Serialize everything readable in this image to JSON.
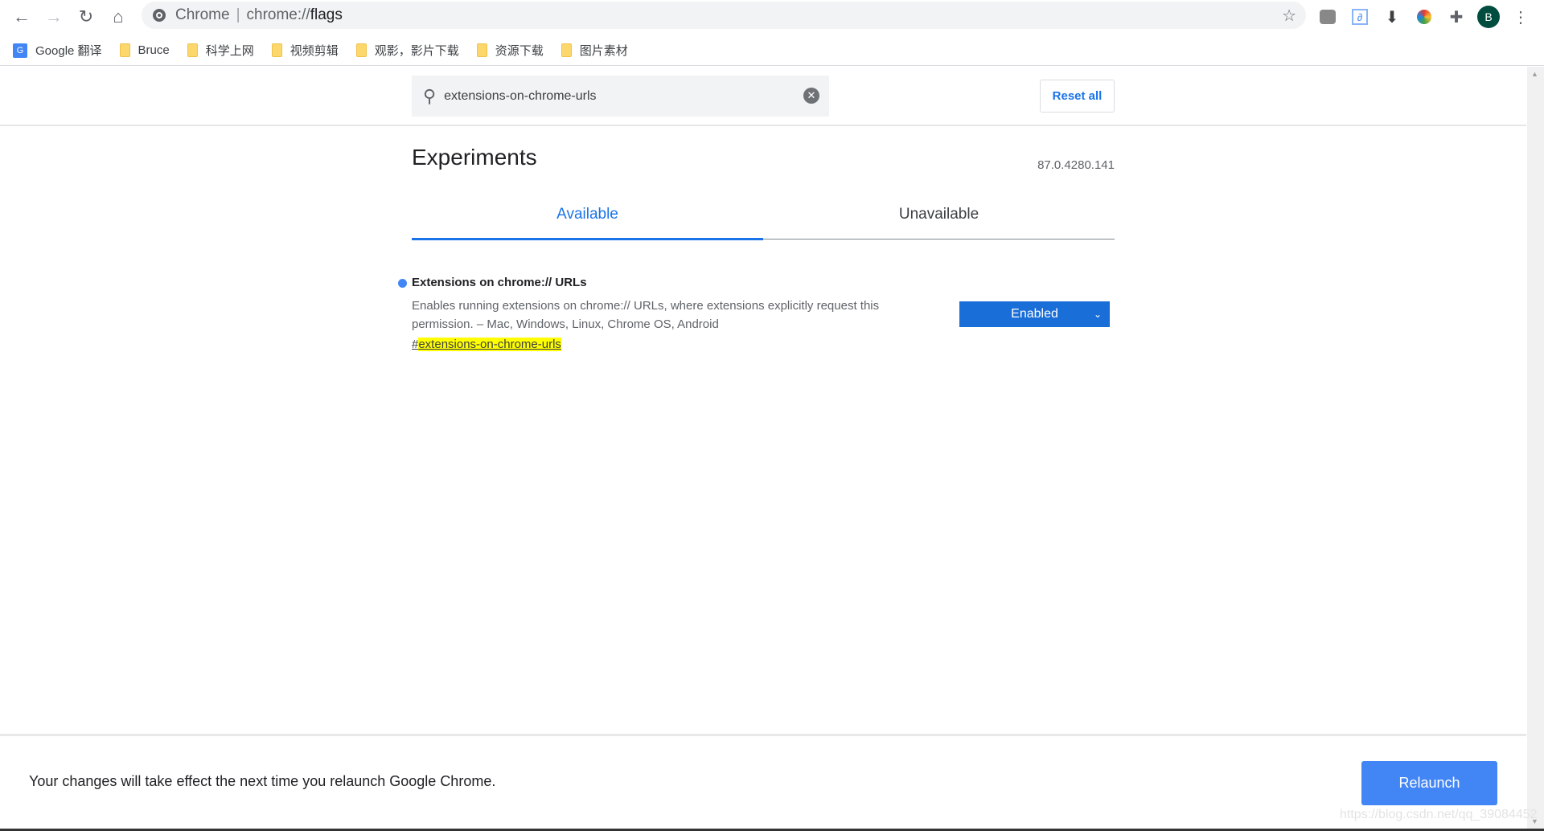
{
  "browser": {
    "site_label": "Chrome",
    "url_prefix": "chrome://",
    "url_path": "flags",
    "avatar_letter": "B",
    "bookmarks": [
      {
        "label": "Google 翻译",
        "icon": "google-translate-icon"
      },
      {
        "label": "Bruce",
        "icon": "folder-icon"
      },
      {
        "label": "科学上网",
        "icon": "folder-icon"
      },
      {
        "label": "视频剪辑",
        "icon": "folder-icon"
      },
      {
        "label": "观影，影片下载",
        "icon": "folder-icon"
      },
      {
        "label": "资源下载",
        "icon": "folder-icon"
      },
      {
        "label": "图片素材",
        "icon": "folder-icon"
      }
    ]
  },
  "search": {
    "value": "extensions-on-chrome-urls"
  },
  "header": {
    "reset_label": "Reset all"
  },
  "page": {
    "title": "Experiments",
    "version": "87.0.4280.141"
  },
  "tabs": [
    {
      "label": "Available",
      "active": true
    },
    {
      "label": "Unavailable",
      "active": false
    }
  ],
  "experiment": {
    "title": "Extensions on chrome:// URLs",
    "description": "Enables running extensions on chrome:// URLs, where extensions explicitly request this permission. – Mac, Windows, Linux, Chrome OS, Android",
    "link_hash": "#",
    "link_name": "extensions-on-chrome-urls",
    "selected": "Enabled"
  },
  "footer": {
    "message": "Your changes will take effect the next time you relaunch Google Chrome.",
    "relaunch_label": "Relaunch"
  },
  "watermark": "https://blog.csdn.net/qq_39084452",
  "colors": {
    "accent": "#1a73e8",
    "select_bg": "#1a6ed8",
    "relaunch_bg": "#4285f4",
    "highlight": "#ffff00"
  }
}
